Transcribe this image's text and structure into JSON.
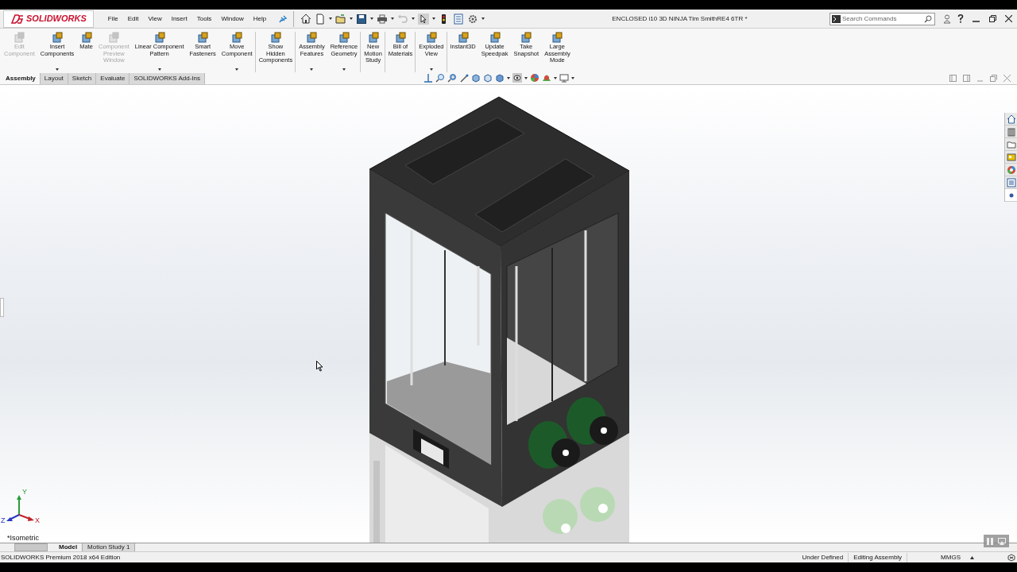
{
  "logo_text": "SOLIDWORKS",
  "menu": [
    {
      "label": "File"
    },
    {
      "label": "Edit"
    },
    {
      "label": "View"
    },
    {
      "label": "Insert"
    },
    {
      "label": "Tools"
    },
    {
      "label": "Window"
    },
    {
      "label": "Help"
    }
  ],
  "title": "ENCLOSED i10 3D NINJA Tim SmithRE4 6TR *",
  "search": {
    "placeholder": "Search Commands"
  },
  "ribbon": [
    {
      "label": "Edit\nComponent",
      "disabled": true,
      "dropdown": false,
      "separator_after": false
    },
    {
      "label": "Insert\nComponents",
      "disabled": false,
      "dropdown": true,
      "separator_after": false
    },
    {
      "label": "Mate",
      "disabled": false,
      "dropdown": false,
      "separator_after": false
    },
    {
      "label": "Component\nPreview\nWindow",
      "disabled": true,
      "dropdown": false,
      "separator_after": false
    },
    {
      "label": "Linear Component\nPattern",
      "disabled": false,
      "dropdown": true,
      "separator_after": false
    },
    {
      "label": "Smart\nFasteners",
      "disabled": false,
      "dropdown": false,
      "separator_after": false
    },
    {
      "label": "Move\nComponent",
      "disabled": false,
      "dropdown": true,
      "separator_after": true
    },
    {
      "label": "Show\nHidden\nComponents",
      "disabled": false,
      "dropdown": false,
      "separator_after": true
    },
    {
      "label": "Assembly\nFeatures",
      "disabled": false,
      "dropdown": true,
      "separator_after": false
    },
    {
      "label": "Reference\nGeometry",
      "disabled": false,
      "dropdown": true,
      "separator_after": true
    },
    {
      "label": "New\nMotion\nStudy",
      "disabled": false,
      "dropdown": false,
      "separator_after": true
    },
    {
      "label": "Bill of\nMaterials",
      "disabled": false,
      "dropdown": false,
      "separator_after": true
    },
    {
      "label": "Exploded\nView",
      "disabled": false,
      "dropdown": true,
      "separator_after": true
    },
    {
      "label": "Instant3D",
      "disabled": false,
      "dropdown": false,
      "separator_after": false
    },
    {
      "label": "Update\nSpeedpak",
      "disabled": false,
      "dropdown": false,
      "separator_after": false
    },
    {
      "label": "Take\nSnapshot",
      "disabled": false,
      "dropdown": false,
      "separator_after": false
    },
    {
      "label": "Large\nAssembly\nMode",
      "disabled": false,
      "dropdown": false,
      "separator_after": false
    }
  ],
  "tabs": [
    {
      "label": "Assembly",
      "selected": true
    },
    {
      "label": "Layout",
      "selected": false
    },
    {
      "label": "Sketch",
      "selected": false
    },
    {
      "label": "Evaluate",
      "selected": false
    },
    {
      "label": "SOLIDWORKS Add-Ins",
      "selected": false
    }
  ],
  "triad": {
    "x": "X",
    "y": "Y",
    "z": "Z"
  },
  "view_label": "*Isometric",
  "bottom_tabs": [
    {
      "label": "Model",
      "selected": true
    },
    {
      "label": "Motion Study 1",
      "selected": false
    }
  ],
  "status_bar": {
    "edition": "SOLIDWORKS Premium 2018 x64 Edition",
    "states": [
      "Under Defined",
      "Editing Assembly"
    ],
    "units": "MMGS"
  }
}
